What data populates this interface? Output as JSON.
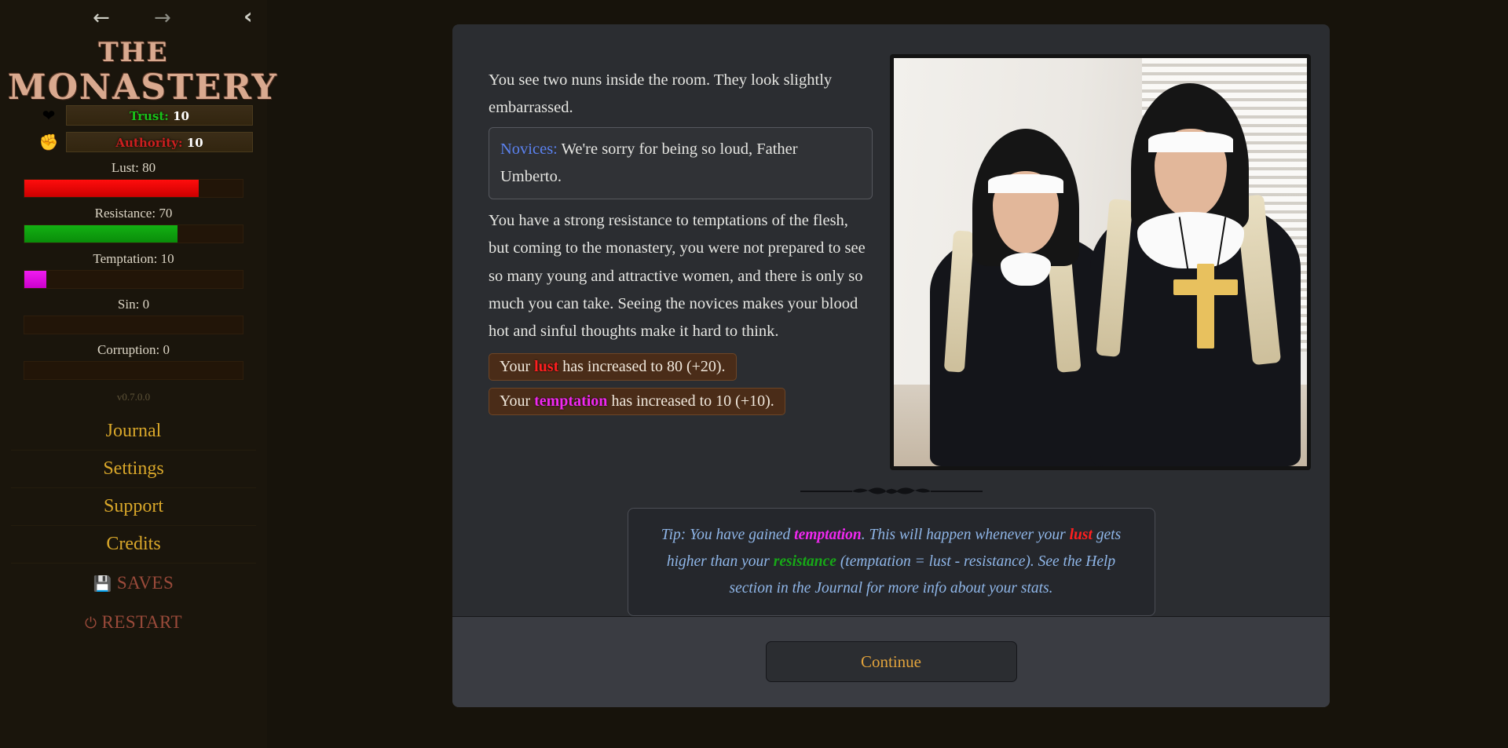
{
  "sidebar": {
    "nav": {
      "back_icon": "arrow-left-icon",
      "forward_icon": "arrow-right-icon",
      "collapse_icon": "chevron-left-icon",
      "back_glyph": "←",
      "forward_glyph": "→",
      "collapse_glyph": "‹"
    },
    "title_line1": "THE",
    "title_line2": "MONASTERY",
    "pills": [
      {
        "icon": "heart-icon",
        "glyph": "❤",
        "label": "Trust:",
        "value": "10",
        "label_class": "lbl-trust"
      },
      {
        "icon": "fist-icon",
        "glyph": "✊",
        "label": "Authority:",
        "value": "10",
        "label_class": "lbl-auth"
      }
    ],
    "meters": [
      {
        "name": "lust",
        "label": "Lust: 80",
        "percent": 80
      },
      {
        "name": "resistance",
        "label": "Resistance: 70",
        "percent": 70
      },
      {
        "name": "temptation",
        "label": "Temptation: 10",
        "percent": 10
      },
      {
        "name": "sin",
        "label": "Sin: 0",
        "percent": 0
      },
      {
        "name": "corruption",
        "label": "Corruption: 0",
        "percent": 0
      }
    ],
    "version": "v0.7.0.0",
    "menu": [
      {
        "label": "Journal"
      },
      {
        "label": "Settings"
      },
      {
        "label": "Support"
      },
      {
        "label": "Credits"
      }
    ],
    "saves": {
      "label": "SAVES",
      "icon": "floppy-disk-icon",
      "glyph": "💾"
    },
    "restart": {
      "label": "RESTART",
      "icon": "power-icon",
      "glyph": "⏻"
    }
  },
  "story": {
    "paragraph1": "You see two nuns inside the room. They look slightly embarrassed.",
    "dialog": {
      "speaker": "Novices:",
      "line": "We're sorry for being so loud, Father Umberto."
    },
    "paragraph2": "You have a strong resistance to temptations of the flesh, but coming to the monastery, you were not prepared to see so many young and attractive women, and there is only so much you can take. Seeing the novices makes your blood hot and sinful thoughts make it hard to think.",
    "stat_changes": [
      {
        "prefix": "Your ",
        "keyword": "lust",
        "keyword_class": "k-lust",
        "suffix": " has increased to 80 (+20)."
      },
      {
        "prefix": "Your ",
        "keyword": "temptation",
        "keyword_class": "k-temp",
        "suffix": " has increased to 10 (+10)."
      }
    ],
    "image_alt": "two-nuns-scene"
  },
  "tip": {
    "seg1": "Tip: You have gained ",
    "kw1": "temptation",
    "seg2": ". This will happen whenever your ",
    "kw2": "lust",
    "seg3": " gets higher than your ",
    "kw3": "resistance",
    "seg4": " (temptation = lust - resistance). See the Help section in the Journal for more info about your stats."
  },
  "footer": {
    "continue_label": "Continue"
  },
  "colors": {
    "accent_gold": "#d9a72a",
    "lust_red": "#ff1f1f",
    "resistance_green": "#17a817",
    "temptation_magenta": "#f028f0",
    "trust_green": "#19c219",
    "authority_red": "#cc1f1f",
    "speaker_blue": "#5b82f0",
    "tip_blue": "#8fb6e8",
    "panel_bg": "#2b2d31",
    "footer_bg": "#3a3c42",
    "sidebar_bg": "#1a150c"
  }
}
